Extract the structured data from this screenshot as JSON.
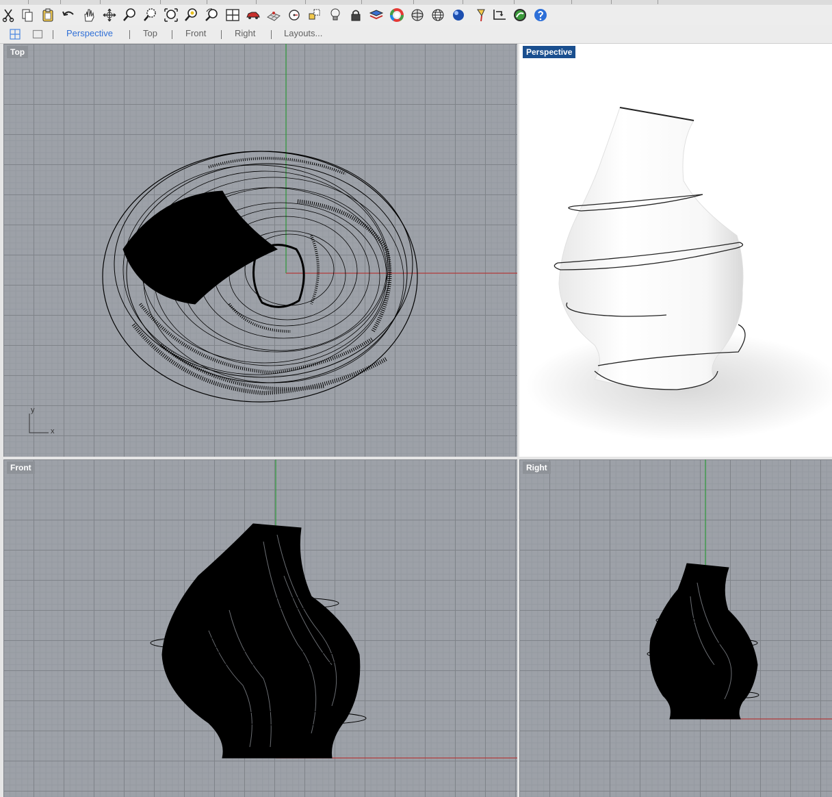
{
  "toolbar": {
    "tools": [
      {
        "icon": "cut-icon"
      },
      {
        "icon": "copy-icon"
      },
      {
        "icon": "paste-icon"
      },
      {
        "icon": "undo-icon"
      },
      {
        "icon": "pan-icon"
      },
      {
        "icon": "rotate-view-icon"
      },
      {
        "icon": "zoom-icon"
      },
      {
        "icon": "zoom-window-icon"
      },
      {
        "icon": "zoom-extents-icon"
      },
      {
        "icon": "zoom-selected-icon"
      },
      {
        "icon": "undo-view-icon"
      },
      {
        "icon": "viewport-layout-icon"
      },
      {
        "icon": "car-icon"
      },
      {
        "icon": "grid-plane-icon"
      },
      {
        "icon": "named-view-icon"
      },
      {
        "icon": "select-filter-icon"
      },
      {
        "icon": "light-bulb-icon"
      },
      {
        "icon": "lock-icon"
      },
      {
        "icon": "layer-icon"
      },
      {
        "icon": "color-wheel-icon"
      },
      {
        "icon": "shaded-sphere-icon"
      },
      {
        "icon": "mesh-sphere-icon"
      },
      {
        "icon": "render-sphere-icon"
      },
      {
        "icon": "paint-brush-icon"
      },
      {
        "icon": "dimension-icon"
      },
      {
        "icon": "rhino-logo-icon"
      },
      {
        "icon": "help-icon"
      }
    ]
  },
  "view_tabs": {
    "layout_icon": "four-viewports-icon",
    "single_icon": "single-viewport-icon",
    "tabs": [
      {
        "label": "Perspective",
        "active": true
      },
      {
        "label": "Top",
        "active": false
      },
      {
        "label": "Front",
        "active": false
      },
      {
        "label": "Right",
        "active": false
      },
      {
        "label": "Layouts...",
        "active": false
      }
    ]
  },
  "viewports": {
    "top": {
      "label": "Top",
      "axis_x": "x",
      "axis_y": "y"
    },
    "perspective": {
      "label": "Perspective"
    },
    "front": {
      "label": "Front"
    },
    "right": {
      "label": "Right"
    }
  },
  "colors": {
    "grid_background": "#9da1a8",
    "x_axis": "#b23a3a",
    "y_axis": "#2e9a3a",
    "active_label": "#1a4f8f",
    "active_tab": "#2f6fd6"
  }
}
